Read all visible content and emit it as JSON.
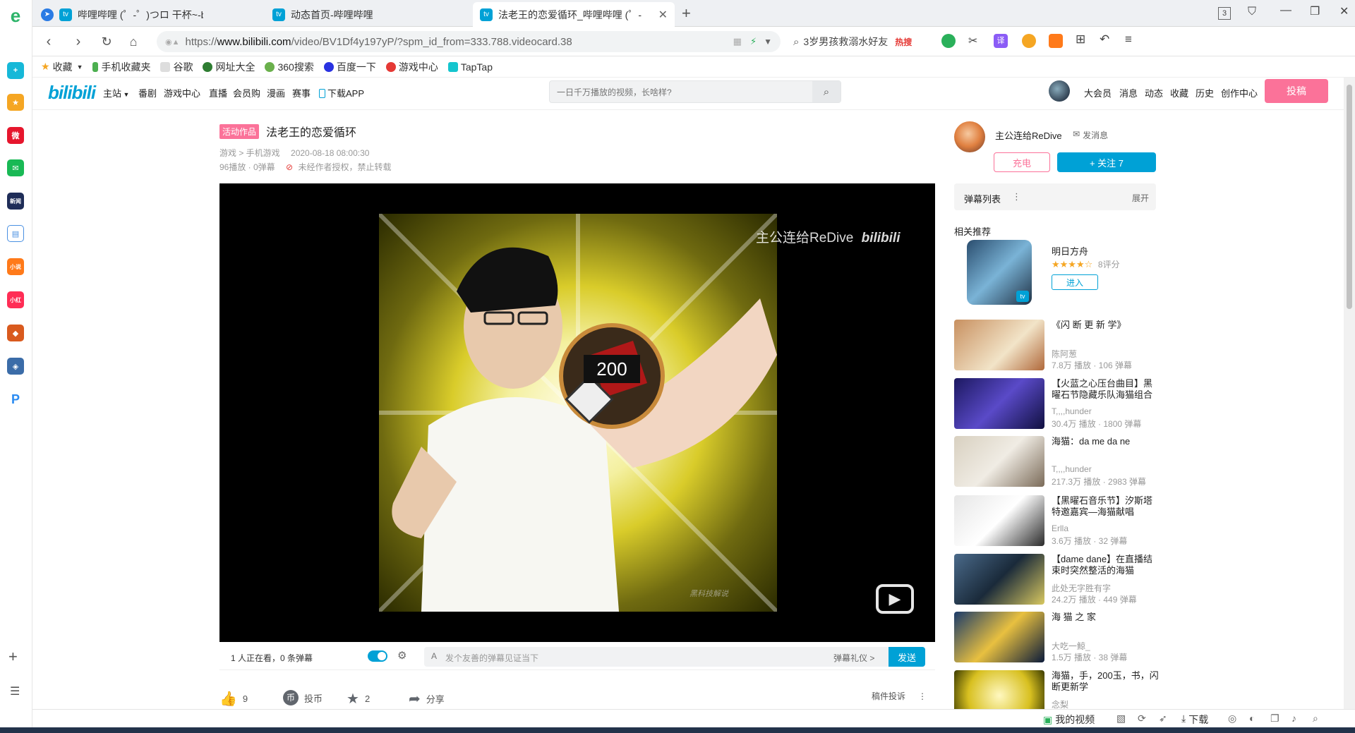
{
  "tabs": [
    {
      "title": "哔哩哔哩 (゜-゜)つロ 干杯~-bilibi",
      "active": false
    },
    {
      "title": "动态首页-哔哩哔哩",
      "active": false
    },
    {
      "title": "法老王的恋爱循环_哔哩哔哩 (゜-",
      "active": true
    }
  ],
  "tabstrip": {
    "new_tab": "+",
    "tab_count": "3"
  },
  "address": {
    "url_prefix": "https://",
    "url_host": "www.bilibili.com",
    "url_path": "/video/BV1Df4y197yP/?spm_id_from=333.788.videocard.38"
  },
  "search": {
    "query": "3岁男孩救溺水好友",
    "hot_label": "热搜"
  },
  "bookmarks": [
    {
      "label": "收藏",
      "color": "#f5a623"
    },
    {
      "label": "手机收藏夹",
      "color": "#4caf50"
    },
    {
      "label": "谷歌",
      "color": "#bbb"
    },
    {
      "label": "网址大全",
      "color": "#2e7d32"
    },
    {
      "label": "360搜索",
      "color": "#6ab04c"
    },
    {
      "label": "百度一下",
      "color": "#2932e1"
    },
    {
      "label": "游戏中心",
      "color": "#e53935"
    },
    {
      "label": "TapTap",
      "color": "#15c5ce"
    }
  ],
  "bili_header": {
    "logo": "bilibili",
    "nav": [
      "主站",
      "番剧",
      "游戏中心",
      "直播",
      "会员购",
      "漫画",
      "赛事",
      "下载APP"
    ],
    "search_placeholder": "一日千万播放的视频，长啥样?",
    "right_nav": [
      "大会员",
      "消息",
      "动态",
      "收藏",
      "历史",
      "创作中心"
    ],
    "upload_label": "投稿"
  },
  "video": {
    "tag": "活动作品",
    "title": "法老王的恋爱循环",
    "category": "游戏 > 手机游戏",
    "date": "2020-08-18 08:00:30",
    "stats": "96播放 · 0弹幕",
    "copyright": "未经作者授权，禁止转载",
    "watermark": "主公连给ReDive",
    "watermark_logo": "bilibili",
    "overlay_number": "200",
    "frame_watermark": "黑科技解说"
  },
  "controls": {
    "watching": "1 人正在看，0 条弹幕",
    "dmk_placeholder": "发个友善的弹幕见证当下",
    "dmk_etiquette": "弹幕礼仪 >",
    "send_label": "发送"
  },
  "actions": {
    "like_count": "9",
    "coin_label": "投币",
    "fav_count": "2",
    "share_label": "分享",
    "report_label": "稿件投诉"
  },
  "uploader": {
    "name": "主公连给ReDive",
    "message_label": "发消息",
    "charge_label": "充电",
    "follow_label": "+ 关注 7"
  },
  "danmaku_panel": {
    "title": "弹幕列表",
    "expand": "展开"
  },
  "related": {
    "heading": "相关推荐",
    "game": {
      "title": "明日方舟",
      "rating": "8评分",
      "enter": "进入"
    },
    "items": [
      {
        "title": "《闪 断 更 新 学》",
        "up": "陈阿葱",
        "stat": "7.8万 播放 · 106 弹幕"
      },
      {
        "title": "【火蓝之心压台曲目】黑曜石节隐藏乐队海猫组合为…",
        "up": "T,,,,hunder",
        "stat": "30.4万 播放 · 1800 弹幕"
      },
      {
        "title": "海猫：da me da ne",
        "up": "T,,,,hunder",
        "stat": "217.3万 播放 · 2983 弹幕"
      },
      {
        "title": "【黑曜石音乐节】汐斯塔特邀嘉宾—海猫献唱《Butt…",
        "up": "Erlla",
        "stat": "3.6万 播放 · 32 弹幕"
      },
      {
        "title": "【dame dane】在直播结束时突然整活的海猫",
        "up": "此处无字胜有字",
        "stat": "24.2万 播放 · 449 弹幕"
      },
      {
        "title": "海 猫 之 家",
        "up": "大吃一鯨_",
        "stat": "1.5万 播放 · 38 弹幕"
      },
      {
        "title": "海猫，手，200玉，书，闪断更新学",
        "up": "念梨",
        "stat": ""
      }
    ]
  },
  "statusbar": {
    "my_video": "我的视频",
    "download": "下载"
  },
  "colors": {
    "bili_pink": "#fb7299",
    "bili_blue": "#00a1d6"
  }
}
